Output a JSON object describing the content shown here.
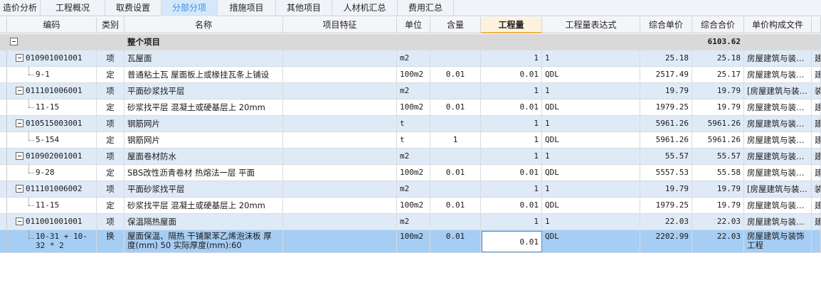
{
  "tabs": [
    {
      "label": "造价分析",
      "active": false
    },
    {
      "label": "工程概况",
      "active": false
    },
    {
      "label": "取费设置",
      "active": false
    },
    {
      "label": "分部分项",
      "active": true
    },
    {
      "label": "措施项目",
      "active": false
    },
    {
      "label": "其他项目",
      "active": false
    },
    {
      "label": "人材机汇总",
      "active": false
    },
    {
      "label": "费用汇总",
      "active": false
    }
  ],
  "columns": [
    "编码",
    "类别",
    "名称",
    "项目特征",
    "单位",
    "含量",
    "工程量",
    "工程量表达式",
    "综合单价",
    "综合合价",
    "单价构成文件"
  ],
  "total_row": {
    "name": "整个项目",
    "total": "6103.62"
  },
  "rows": [
    {
      "kind": "item",
      "code": "010901001001",
      "type": "项",
      "name": "瓦屋面",
      "unit": "m2",
      "content": "",
      "qty": "1",
      "expr": "1",
      "price": "25.18",
      "sum": "25.18",
      "file": "房屋建筑与装…",
      "extra": "建"
    },
    {
      "kind": "quota",
      "code": "9-1",
      "type": "定",
      "name": "普通粘土瓦 屋面板上或椽挂瓦条上铺设",
      "unit": "100m2",
      "content": "0.01",
      "qty": "0.01",
      "expr": "QDL",
      "price": "2517.49",
      "sum": "25.17",
      "file": "房屋建筑与装…",
      "extra": "建"
    },
    {
      "kind": "item",
      "code": "011101006001",
      "type": "项",
      "name": "平面砂浆找平层",
      "unit": "m2",
      "content": "",
      "qty": "1",
      "expr": "1",
      "price": "19.79",
      "sum": "19.79",
      "file": "[房屋建筑与装…",
      "extra": "装"
    },
    {
      "kind": "quota",
      "code": "11-15",
      "type": "定",
      "name": "砂浆找平层 混凝土或硬基层上 20mm",
      "unit": "100m2",
      "content": "0.01",
      "qty": "0.01",
      "expr": "QDL",
      "price": "1979.25",
      "sum": "19.79",
      "file": "房屋建筑与装…",
      "extra": "建"
    },
    {
      "kind": "item",
      "code": "010515003001",
      "type": "项",
      "name": "钢筋网片",
      "unit": "t",
      "content": "",
      "qty": "1",
      "expr": "1",
      "price": "5961.26",
      "sum": "5961.26",
      "file": "房屋建筑与装…",
      "extra": "建"
    },
    {
      "kind": "quota",
      "code": "5-154",
      "type": "定",
      "name": "钢筋网片",
      "unit": "t",
      "content": "1",
      "qty": "1",
      "expr": "QDL",
      "price": "5961.26",
      "sum": "5961.26",
      "file": "房屋建筑与装…",
      "extra": "建"
    },
    {
      "kind": "item",
      "code": "010902001001",
      "type": "项",
      "name": "屋面卷材防水",
      "unit": "m2",
      "content": "",
      "qty": "1",
      "expr": "1",
      "price": "55.57",
      "sum": "55.57",
      "file": "房屋建筑与装…",
      "extra": "建"
    },
    {
      "kind": "quota",
      "code": "9-28",
      "type": "定",
      "name": "SBS改性沥青卷材 热熔法一层 平面",
      "unit": "100m2",
      "content": "0.01",
      "qty": "0.01",
      "expr": "QDL",
      "price": "5557.53",
      "sum": "55.58",
      "file": "房屋建筑与装…",
      "extra": "建"
    },
    {
      "kind": "item",
      "code": "011101006002",
      "type": "项",
      "name": "平面砂浆找平层",
      "unit": "m2",
      "content": "",
      "qty": "1",
      "expr": "1",
      "price": "19.79",
      "sum": "19.79",
      "file": "[房屋建筑与装…",
      "extra": "装"
    },
    {
      "kind": "quota",
      "code": "11-15",
      "type": "定",
      "name": "砂浆找平层 混凝土或硬基层上 20mm",
      "unit": "100m2",
      "content": "0.01",
      "qty": "0.01",
      "expr": "QDL",
      "price": "1979.25",
      "sum": "19.79",
      "file": "房屋建筑与装…",
      "extra": "建"
    },
    {
      "kind": "item",
      "code": "011001001001",
      "type": "项",
      "name": "保温隔热屋面",
      "unit": "m2",
      "content": "",
      "qty": "1",
      "expr": "1",
      "price": "22.03",
      "sum": "22.03",
      "file": "房屋建筑与装…",
      "extra": "建"
    },
    {
      "kind": "selected",
      "code": "10-31 + 10-32 * 2",
      "type": "换",
      "name": "屋面保温、隔热 干铺聚苯乙烯泡沫板 厚度(mm) 50  实际厚度(mm):60",
      "unit": "100m2",
      "content": "0.01",
      "qty": "0.01",
      "expr": "QDL",
      "price": "2202.99",
      "sum": "22.03",
      "file": "房屋建筑与装饰工程",
      "extra": ""
    }
  ]
}
